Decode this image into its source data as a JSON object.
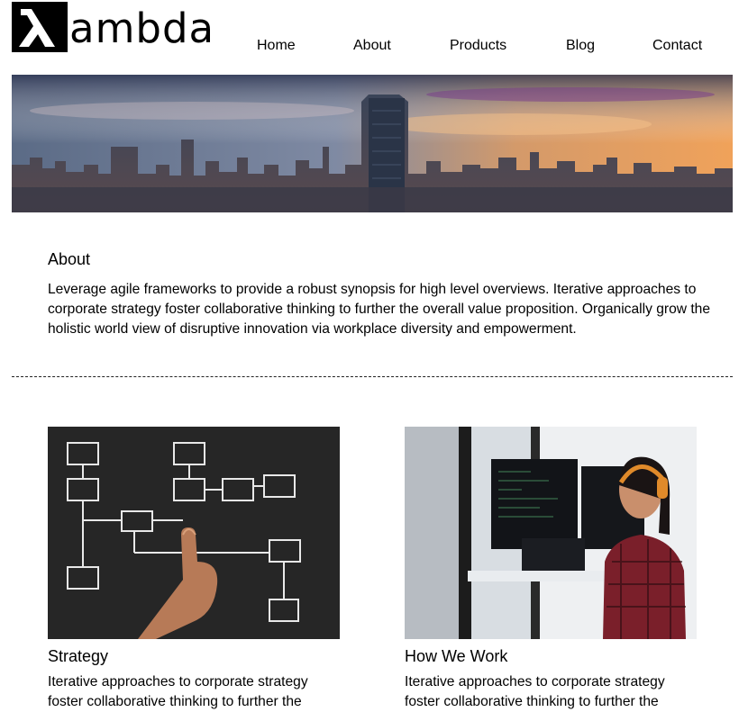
{
  "logo": {
    "symbol": "λ",
    "text": "ambda"
  },
  "nav": {
    "items": [
      {
        "label": "Home"
      },
      {
        "label": "About"
      },
      {
        "label": "Products"
      },
      {
        "label": "Blog"
      },
      {
        "label": "Contact"
      }
    ]
  },
  "hero": {
    "image": "city-skyline-sunset"
  },
  "about": {
    "title": "About",
    "text": "Leverage agile frameworks to provide a robust synopsis for high level overviews. Iterative approaches to corporate strategy foster collaborative thinking to further the overall value proposition. Organically grow the holistic world view of disruptive innovation via workplace diversity and empowerment."
  },
  "cards": [
    {
      "title": "Strategy",
      "image": "chalkboard-flowchart-hand",
      "text": "Iterative approaches to corporate strategy foster collaborative thinking to further the"
    },
    {
      "title": "How We Work",
      "image": "developer-with-headphones-at-monitors",
      "text": "Iterative approaches to corporate strategy foster collaborative thinking to further the"
    }
  ]
}
